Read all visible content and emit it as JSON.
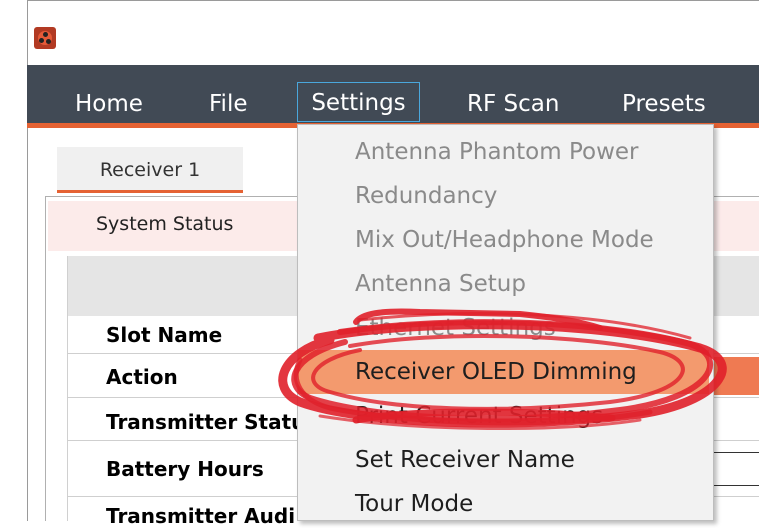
{
  "window": {
    "title": ""
  },
  "menu": {
    "items": [
      {
        "label": "Home"
      },
      {
        "label": "File"
      },
      {
        "label": "Settings"
      },
      {
        "label": "RF Scan"
      },
      {
        "label": "Presets"
      }
    ]
  },
  "tabs": [
    {
      "label": "Receiver 1"
    }
  ],
  "panel": {
    "section_title": "System Status",
    "rows": [
      {
        "label": "Slot Name"
      },
      {
        "label": "Action"
      },
      {
        "label": "Transmitter Statu"
      },
      {
        "label": "Battery Hours"
      },
      {
        "label": "Transmitter Audi"
      }
    ]
  },
  "settings_menu": {
    "items": [
      {
        "label": "Antenna Phantom Power",
        "enabled": false
      },
      {
        "label": "Redundancy",
        "enabled": false
      },
      {
        "label": "Mix Out/Headphone Mode",
        "enabled": false
      },
      {
        "label": "Antenna Setup",
        "enabled": false
      },
      {
        "label": "Ethernet Settings",
        "enabled": false
      },
      {
        "label": "Receiver OLED Dimming",
        "enabled": true,
        "highlighted": true
      },
      {
        "label": "Print Current Settings",
        "enabled": true
      },
      {
        "label": "Set Receiver Name",
        "enabled": true
      },
      {
        "label": "Tour Mode",
        "enabled": true
      }
    ]
  },
  "colors": {
    "menu_bar": "#414a55",
    "accent": "#e56233",
    "focus_border": "#4aa7dc",
    "highlight": "#f39a6e",
    "scribble": "#e0202a"
  },
  "icons": {
    "app": "app-logo-icon"
  }
}
